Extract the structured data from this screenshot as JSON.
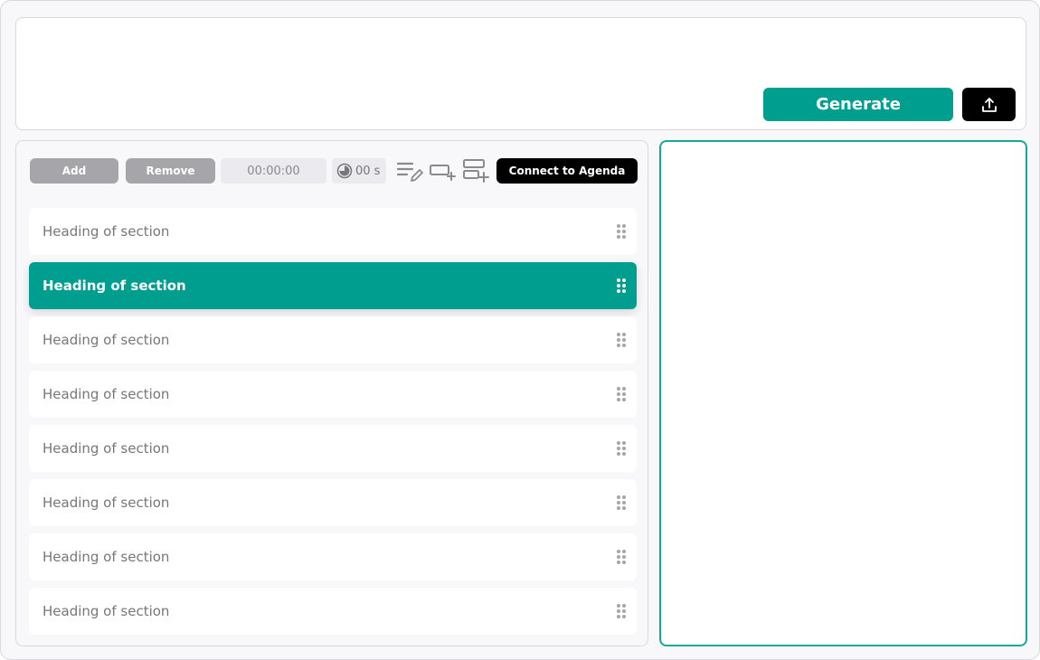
{
  "top": {
    "generate_label": "Generate",
    "export_icon": "upload-icon"
  },
  "toolbar": {
    "add_label": "Add",
    "remove_label": "Remove",
    "time_value": "00:00:00",
    "duration_value": "00 s",
    "connect_label": "Connect to Agenda",
    "icons": [
      "edit-list-icon",
      "add-box-icon",
      "add-row-icon"
    ]
  },
  "sections": [
    {
      "label": "Heading of section",
      "active": false
    },
    {
      "label": "Heading of section",
      "active": true
    },
    {
      "label": "Heading of section",
      "active": false
    },
    {
      "label": "Heading of section",
      "active": false
    },
    {
      "label": "Heading of section",
      "active": false
    },
    {
      "label": "Heading of section",
      "active": false
    },
    {
      "label": "Heading of section",
      "active": false
    },
    {
      "label": "Heading of section",
      "active": false
    }
  ],
  "colors": {
    "accent": "#009e8f",
    "border_accent": "#15a99b",
    "muted_button": "#a6a5aa"
  }
}
